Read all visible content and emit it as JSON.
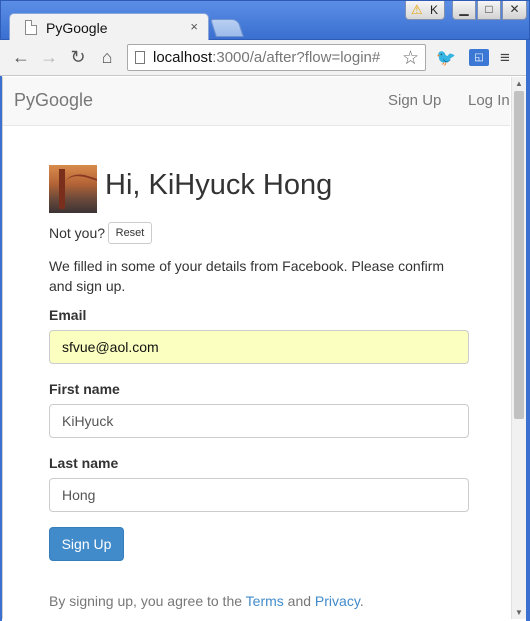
{
  "browser": {
    "tab_title": "PyGoogle",
    "tab_close": "×",
    "profile_letter": "K",
    "url_host": "localhost",
    "url_rest": ":3000/a/after?flow=login#",
    "window_buttons": {
      "minimize": "▁",
      "maximize": "□",
      "close": "✕"
    },
    "icons": {
      "back": "←",
      "forward": "→",
      "reload": "↻",
      "home": "⌂",
      "star": "☆",
      "menu": "≡",
      "warning": "⚠",
      "extension": "◱",
      "bird": "🐦"
    }
  },
  "navbar": {
    "brand": "PyGoogle",
    "sign_up": "Sign Up",
    "log_in": "Log In"
  },
  "profile": {
    "greeting": "Hi, KiHyuck Hong",
    "not_you": "Not you?",
    "reset_label": "Reset"
  },
  "info_text": "We filled in some of your details from Facebook. Please confirm and sign up.",
  "form": {
    "email_label": "Email",
    "email_value": "sfvue@aol.com",
    "first_name_label": "First name",
    "first_name_value": "KiHyuck",
    "last_name_label": "Last name",
    "last_name_value": "Hong",
    "submit_label": "Sign Up"
  },
  "legal": {
    "prefix": "By signing up, you agree to the ",
    "terms": "Terms",
    "and": " and ",
    "privacy": "Privacy",
    "suffix": "."
  },
  "colors": {
    "primary": "#428bca",
    "autofill": "#fbffbf",
    "chrome_frame": "#3b6fd0"
  }
}
